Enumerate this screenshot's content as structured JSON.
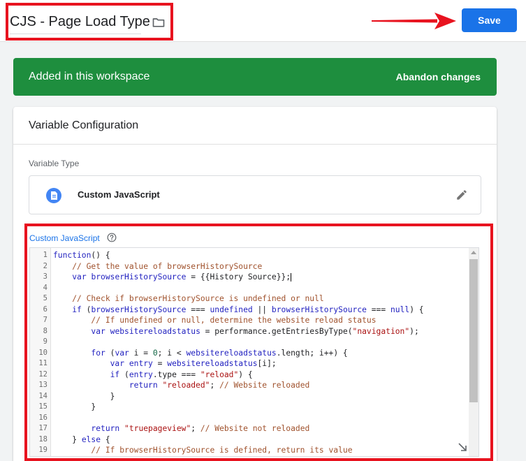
{
  "header": {
    "title": "CJS - Page Load Type",
    "save_label": "Save"
  },
  "banner": {
    "text": "Added in this workspace",
    "action": "Abandon changes"
  },
  "config": {
    "title": "Variable Configuration",
    "type_label": "Variable Type",
    "type_value": "Custom JavaScript",
    "code_label": "Custom JavaScript"
  },
  "code_lines": [
    {
      "n": "1",
      "t": "function() {"
    },
    {
      "n": "2",
      "t": "    // Get the value of browserHistorySource"
    },
    {
      "n": "3",
      "t": "    var browserHistorySource = {{History Source}};"
    },
    {
      "n": "4",
      "t": ""
    },
    {
      "n": "5",
      "t": "    // Check if browserHistorySource is undefined or null"
    },
    {
      "n": "6",
      "t": "    if (browserHistorySource === undefined || browserHistorySource === null) {"
    },
    {
      "n": "7",
      "t": "        // If undefined or null, determine the website reload status"
    },
    {
      "n": "8",
      "t": "        var websitereloadstatus = performance.getEntriesByType(\"navigation\");"
    },
    {
      "n": "9",
      "t": ""
    },
    {
      "n": "10",
      "t": "        for (var i = 0; i < websitereloadstatus.length; i++) {"
    },
    {
      "n": "11",
      "t": "            var entry = websitereloadstatus[i];"
    },
    {
      "n": "12",
      "t": "            if (entry.type === \"reload\") {"
    },
    {
      "n": "13",
      "t": "                return \"reloaded\"; // Website reloaded"
    },
    {
      "n": "14",
      "t": "            }"
    },
    {
      "n": "15",
      "t": "        }"
    },
    {
      "n": "16",
      "t": ""
    },
    {
      "n": "17",
      "t": "        return \"truepageview\"; // Website not reloaded"
    },
    {
      "n": "18",
      "t": "    } else {"
    },
    {
      "n": "19",
      "t": "        // If browserHistorySource is defined, return its value"
    }
  ],
  "colors": {
    "accent": "#1a73e8",
    "banner": "#1e8e3e",
    "highlight": "#e8131f"
  }
}
